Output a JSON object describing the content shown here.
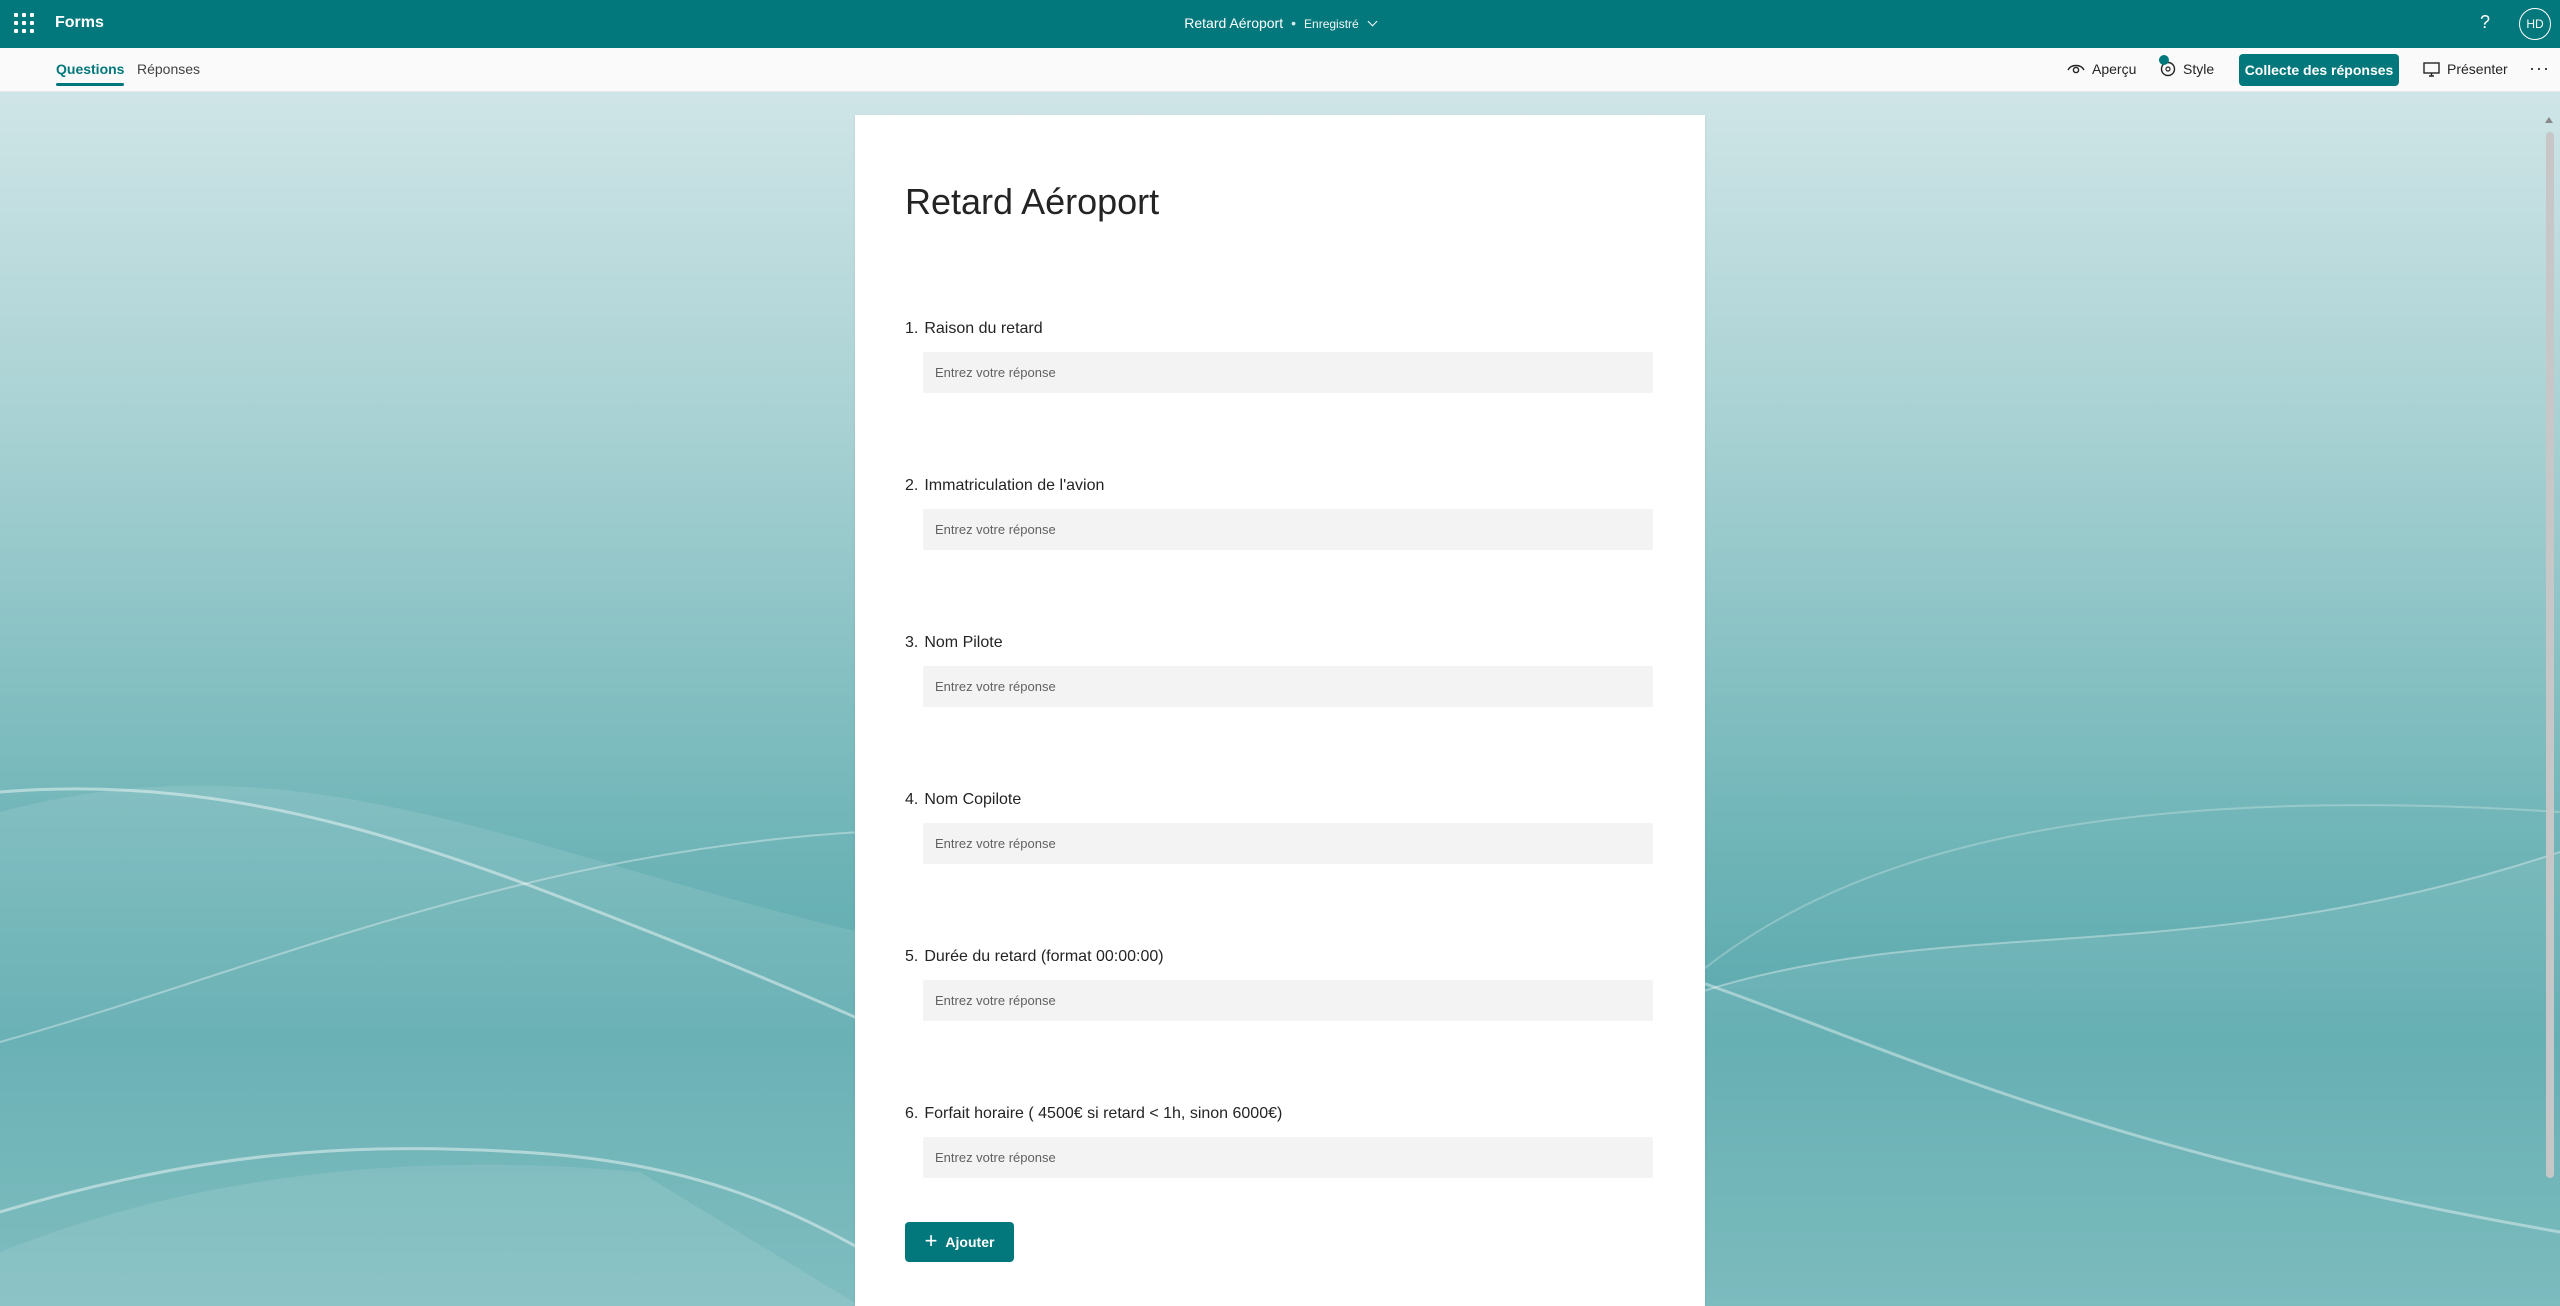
{
  "appbar": {
    "app_name": "Forms",
    "document_title": "Retard Aéroport",
    "separator": "•",
    "save_status": "Enregistré",
    "help_label": "?",
    "avatar_initials": "HD"
  },
  "commandbar": {
    "tabs": [
      {
        "label": "Questions",
        "active": true
      },
      {
        "label": "Réponses",
        "active": false
      }
    ],
    "preview_label": "Aperçu",
    "style_label": "Style",
    "collect_label": "Collecte des réponses",
    "present_label": "Présenter",
    "more_label": "···"
  },
  "form": {
    "title": "Retard Aéroport",
    "questions": [
      {
        "number": "1.",
        "label": "Raison du retard",
        "placeholder": "Entrez votre réponse"
      },
      {
        "number": "2.",
        "label": "Immatriculation de l'avion",
        "placeholder": "Entrez votre réponse"
      },
      {
        "number": "3.",
        "label": "Nom Pilote",
        "placeholder": "Entrez votre réponse"
      },
      {
        "number": "4.",
        "label": "Nom Copilote",
        "placeholder": "Entrez votre réponse"
      },
      {
        "number": "5.",
        "label": "Durée du retard (format 00:00:00)",
        "placeholder": "Entrez votre réponse"
      },
      {
        "number": "6.",
        "label": "Forfait horaire ( 4500€ si retard < 1h, sinon 6000€)",
        "placeholder": "Entrez votre réponse"
      }
    ],
    "add_label": "Ajouter"
  },
  "colors": {
    "accent": "#03787c",
    "input_bg": "#f3f3f3"
  }
}
